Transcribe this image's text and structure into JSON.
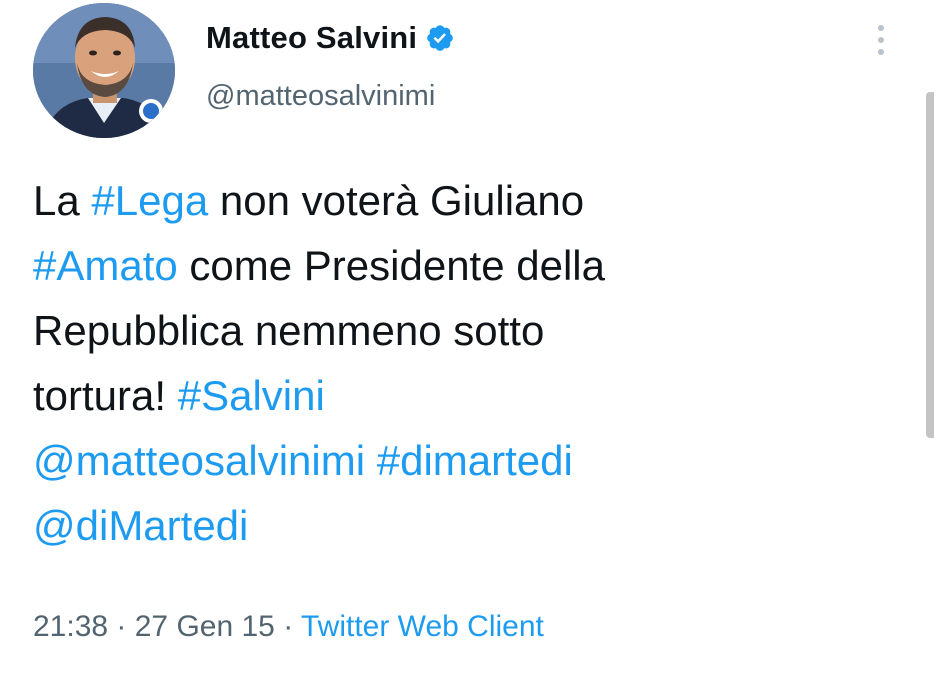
{
  "author": {
    "display_name": "Matteo Salvini",
    "handle": "@matteosalvinimi",
    "verified": true
  },
  "icons": {
    "verified": "verified-badge-icon",
    "more": "more-options-icon"
  },
  "tweet": {
    "lines": [
      [
        {
          "t": "La ",
          "link": false
        },
        {
          "t": "#Lega",
          "link": true
        },
        {
          "t": " non voterà Giuliano",
          "link": false
        }
      ],
      [
        {
          "t": "#Amato",
          "link": true
        },
        {
          "t": " come Presidente della",
          "link": false
        }
      ],
      [
        {
          "t": "Repubblica nemmeno sotto",
          "link": false
        }
      ],
      [
        {
          "t": "tortura!  ",
          "link": false
        },
        {
          "t": "#Salvini",
          "link": true
        }
      ],
      [
        {
          "t": "@matteosalvinimi",
          "link": true
        },
        {
          "t": " ",
          "link": false
        },
        {
          "t": "#dimartedi",
          "link": true
        }
      ],
      [
        {
          "t": "@diMartedi",
          "link": true
        }
      ]
    ]
  },
  "meta": {
    "time": "21:38",
    "sep1": " · ",
    "date": "27 Gen 15",
    "sep2": " · ",
    "source": "Twitter Web Client"
  },
  "colors": {
    "link": "#1d9bf0",
    "text": "#0f1419",
    "secondary": "#536471"
  }
}
